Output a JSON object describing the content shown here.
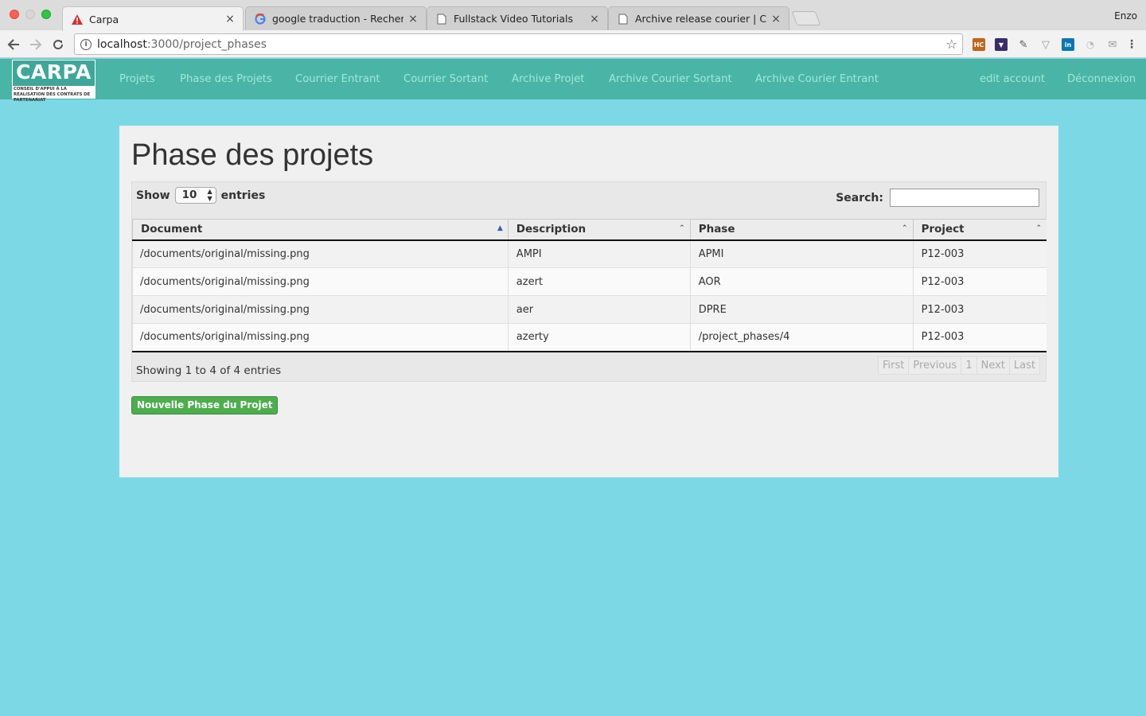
{
  "browser": {
    "tabs": [
      {
        "title": "Carpa",
        "icon": "warning-icon",
        "active": true
      },
      {
        "title": "google traduction - Recherche",
        "icon": "google-icon",
        "active": false
      },
      {
        "title": "Fullstack Video Tutorials",
        "icon": "page-icon",
        "active": false
      },
      {
        "title": "Archive release courier | CARP",
        "icon": "page-icon",
        "active": false
      }
    ],
    "close_glyph": "×",
    "profile_name": "Enzo",
    "url_host": "localhost",
    "url_path": ":3000/project_phases",
    "extensions": [
      "hc-extension-icon",
      "pocket-icon",
      "eyedropper-icon",
      "vue-devtools-icon",
      "linkedin-icon",
      "ghost-extension-icon",
      "mail-extension-icon",
      "menu-icon"
    ]
  },
  "app": {
    "logo": {
      "word": "CARPA",
      "subtitle": "Conseil d'appui à la réalisation des contrats de partenariat"
    },
    "nav_left": [
      "Projets",
      "Phase des Projets",
      "Courrier Entrant",
      "Courrier Sortant",
      "Archive Projet",
      "Archive Courier Sortant",
      "Archive Courier Entrant"
    ],
    "nav_right": [
      "edit account",
      "Déconnexion"
    ],
    "colors": {
      "nav_bg": "#4ab5a6",
      "nav_link": "#9ee8d9",
      "page_bg": "#7dd8e6",
      "button": "#4cae4c"
    }
  },
  "page": {
    "title": "Phase des projets",
    "length": {
      "show_label": "Show",
      "value": "10",
      "entries_label": "entries"
    },
    "search_label": "Search:",
    "search_value": "",
    "columns": [
      "Document",
      "Description",
      "Phase",
      "Project"
    ],
    "rows": [
      [
        "/documents/original/missing.png",
        "AMPI",
        "APMI",
        "P12-003"
      ],
      [
        "/documents/original/missing.png",
        "azert",
        "AOR",
        "P12-003"
      ],
      [
        "/documents/original/missing.png",
        "aer",
        "DPRE",
        "P12-003"
      ],
      [
        "/documents/original/missing.png",
        "azerty",
        "/project_phases/4",
        "P12-003"
      ]
    ],
    "info": "Showing 1 to 4 of 4 entries",
    "pagination": [
      "First",
      "Previous",
      "1",
      "Next",
      "Last"
    ],
    "new_button": "Nouvelle Phase du Projet"
  }
}
